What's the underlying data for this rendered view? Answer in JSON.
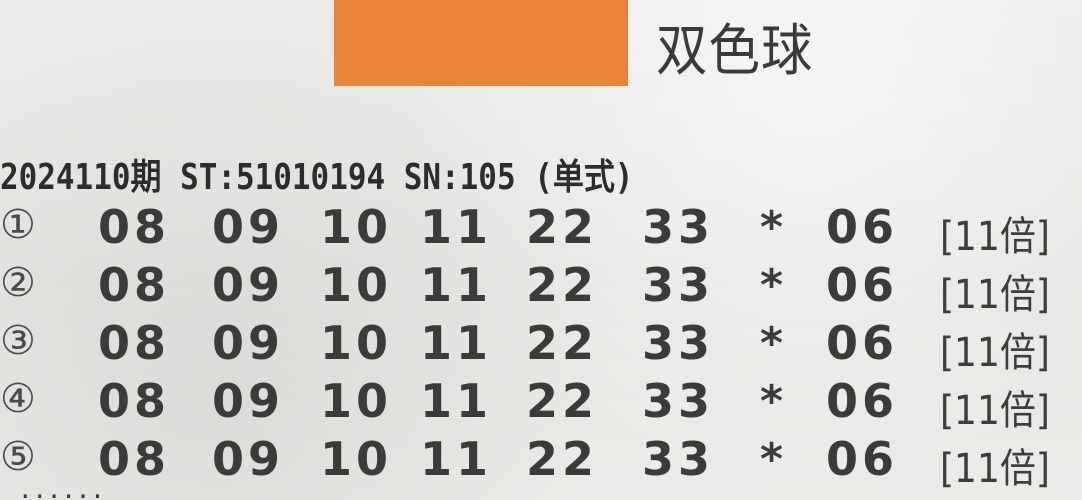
{
  "header": {
    "game_title": "双色球"
  },
  "draw": {
    "info_line": "2024110期 ST:51010194 SN:105 (单式)"
  },
  "bets": [
    {
      "index": "①",
      "reds": [
        "08",
        "09",
        "10",
        "11",
        "22",
        "33"
      ],
      "separator": "*",
      "blue": "06",
      "multiple": "[11倍]"
    },
    {
      "index": "②",
      "reds": [
        "08",
        "09",
        "10",
        "11",
        "22",
        "33"
      ],
      "separator": "*",
      "blue": "06",
      "multiple": "[11倍]"
    },
    {
      "index": "③",
      "reds": [
        "08",
        "09",
        "10",
        "11",
        "22",
        "33"
      ],
      "separator": "*",
      "blue": "06",
      "multiple": "[11倍]"
    },
    {
      "index": "④",
      "reds": [
        "08",
        "09",
        "10",
        "11",
        "22",
        "33"
      ],
      "separator": "*",
      "blue": "06",
      "multiple": "[11倍]"
    },
    {
      "index": "⑤",
      "reds": [
        "08",
        "09",
        "10",
        "11",
        "22",
        "33"
      ],
      "separator": "*",
      "blue": "06",
      "multiple": "[11倍]"
    }
  ],
  "colors": {
    "orange_block": "#ea843b",
    "paper": "#e8e6e3",
    "ink": "#2f2f2f"
  }
}
